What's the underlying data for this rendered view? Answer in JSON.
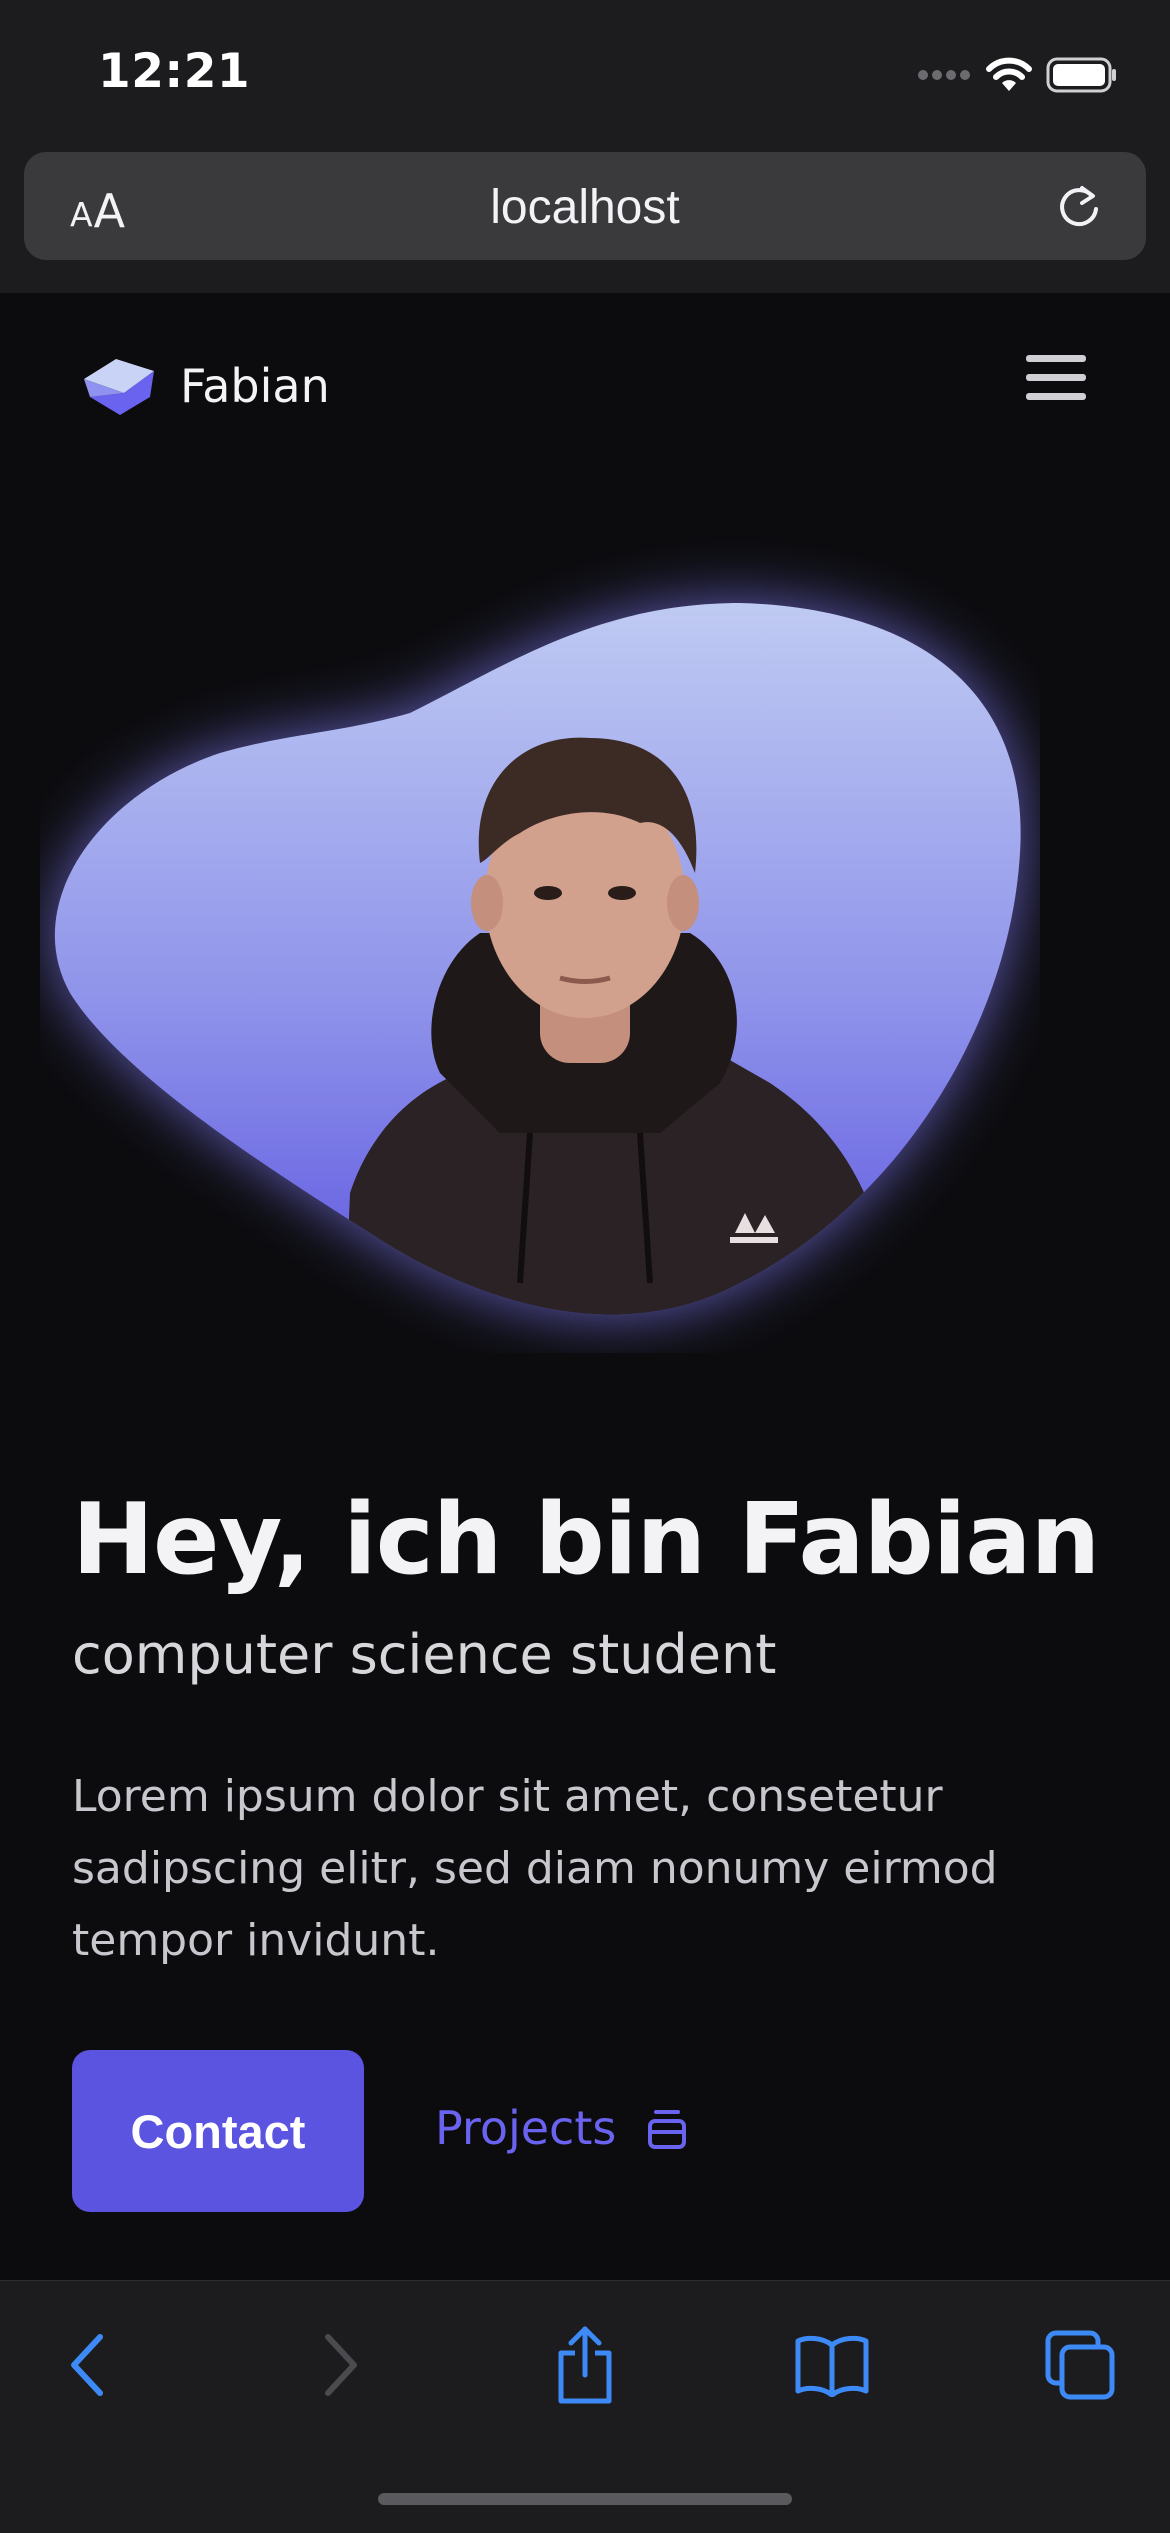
{
  "status_bar": {
    "time": "12:21",
    "icons": [
      "signal-icon",
      "wifi-icon",
      "battery-icon"
    ]
  },
  "browser": {
    "reader_small": "A",
    "reader_big": "A",
    "url": "localhost"
  },
  "nav": {
    "brand_name": "Fabian"
  },
  "hero": {
    "headline": "Hey, ich bin Fabian",
    "subhead": "computer science student",
    "intro": "Lorem ipsum dolor sit amet, consetetur sadipscing elitr, sed diam nonumy eirmod tempor invidunt.",
    "contact_label": "Contact",
    "projects_label": "Projects"
  },
  "colors": {
    "accent": "#5b54e0",
    "link": "#6a63f0",
    "background": "#0c0c0f",
    "chrome": "#1c1c1e",
    "toolbar_icon": "#3d8af7"
  },
  "toolbar": {
    "buttons": [
      "back-icon",
      "forward-icon",
      "share-icon",
      "bookmarks-icon",
      "tabs-icon"
    ]
  }
}
